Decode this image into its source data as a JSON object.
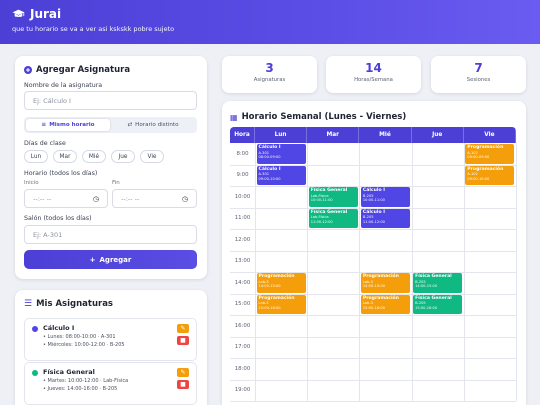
{
  "header": {
    "title": "Jurai",
    "subtitle": "que tu horario se va a ver asi kskskk pobre sujeto"
  },
  "form": {
    "title": "Agregar Asignatura",
    "name_label": "Nombre de la asignatura",
    "name_placeholder": "Ej: Cálculo I",
    "mode_same": "Mismo horario",
    "mode_diff": "Horario distinto",
    "days_label": "Días de clase",
    "days": [
      "Lun",
      "Mar",
      "Mié",
      "Jue",
      "Vie"
    ],
    "time_label": "Horario (todos los días)",
    "start_label": "Inicio",
    "end_label": "Fin",
    "time_placeholder": "--:-- --",
    "room_label": "Salón (todos los días)",
    "room_placeholder": "Ej: A-301",
    "add_button": "Agregar"
  },
  "subjects": {
    "title": "Mis Asignaturas",
    "items": [
      {
        "name": "Cálculo I",
        "color": "#4f46e5",
        "lines": [
          "Lunes: 08:00-10:00 · A-301",
          "Miércoles: 10:00-12:00 · B-205"
        ]
      },
      {
        "name": "Física General",
        "color": "#10b981",
        "lines": [
          "Martes: 10:00-12:00 · Lab-Física",
          "Jueves: 14:00-16:00 · B-205"
        ]
      }
    ]
  },
  "stats": [
    {
      "value": "3",
      "label": "Asignaturas"
    },
    {
      "value": "14",
      "label": "Horas/Semana"
    },
    {
      "value": "7",
      "label": "Sesiones"
    }
  ],
  "schedule": {
    "title": "Horario Semanal (Lunes - Viernes)",
    "columns": [
      "Hora",
      "Lun",
      "Mar",
      "Mié",
      "Jue",
      "Vie"
    ],
    "hours": [
      "8:00",
      "9:00",
      "10:00",
      "11:00",
      "12:00",
      "13:00",
      "14:00",
      "15:00",
      "16:00",
      "17:00",
      "18:00",
      "19:00"
    ],
    "events": [
      {
        "day": 0,
        "start": 8,
        "end": 9,
        "title": "Cálculo I",
        "room": "A-301",
        "time": "08:00-09:00",
        "color": "#4f46e5"
      },
      {
        "day": 0,
        "start": 9,
        "end": 10,
        "title": "Cálculo I",
        "room": "A-301",
        "time": "09:00-10:00",
        "color": "#4f46e5"
      },
      {
        "day": 1,
        "start": 10,
        "end": 11,
        "title": "Física General",
        "room": "Lab-Física",
        "time": "10:00-11:00",
        "color": "#10b981"
      },
      {
        "day": 1,
        "start": 11,
        "end": 12,
        "title": "Física General",
        "room": "Lab-Física",
        "time": "11:00-12:00",
        "color": "#10b981"
      },
      {
        "day": 2,
        "start": 10,
        "end": 11,
        "title": "Cálculo I",
        "room": "B-205",
        "time": "10:00-11:00",
        "color": "#4f46e5"
      },
      {
        "day": 2,
        "start": 11,
        "end": 12,
        "title": "Cálculo I",
        "room": "B-205",
        "time": "11:00-12:00",
        "color": "#4f46e5"
      },
      {
        "day": 4,
        "start": 8,
        "end": 9,
        "title": "Programación",
        "room": "A-102",
        "time": "08:00-09:00",
        "color": "#f59e0b"
      },
      {
        "day": 4,
        "start": 9,
        "end": 10,
        "title": "Programación",
        "room": "A-102",
        "time": "09:00-10:00",
        "color": "#f59e0b"
      },
      {
        "day": 0,
        "start": 14,
        "end": 15,
        "title": "Programación",
        "room": "Lab-3",
        "time": "14:00-15:00",
        "color": "#f59e0b"
      },
      {
        "day": 0,
        "start": 15,
        "end": 16,
        "title": "Programación",
        "room": "Lab-3",
        "time": "15:00-16:00",
        "color": "#f59e0b"
      },
      {
        "day": 2,
        "start": 14,
        "end": 15,
        "title": "Programación",
        "room": "Lab-3",
        "time": "14:00-15:00",
        "color": "#f59e0b"
      },
      {
        "day": 2,
        "start": 15,
        "end": 16,
        "title": "Programación",
        "room": "Lab-3",
        "time": "15:00-16:00",
        "color": "#f59e0b"
      },
      {
        "day": 3,
        "start": 14,
        "end": 15,
        "title": "Física General",
        "room": "B-205",
        "time": "14:00-15:00",
        "color": "#10b981"
      },
      {
        "day": 3,
        "start": 15,
        "end": 16,
        "title": "Física General",
        "room": "B-205",
        "time": "15:00-16:00",
        "color": "#10b981"
      }
    ]
  }
}
